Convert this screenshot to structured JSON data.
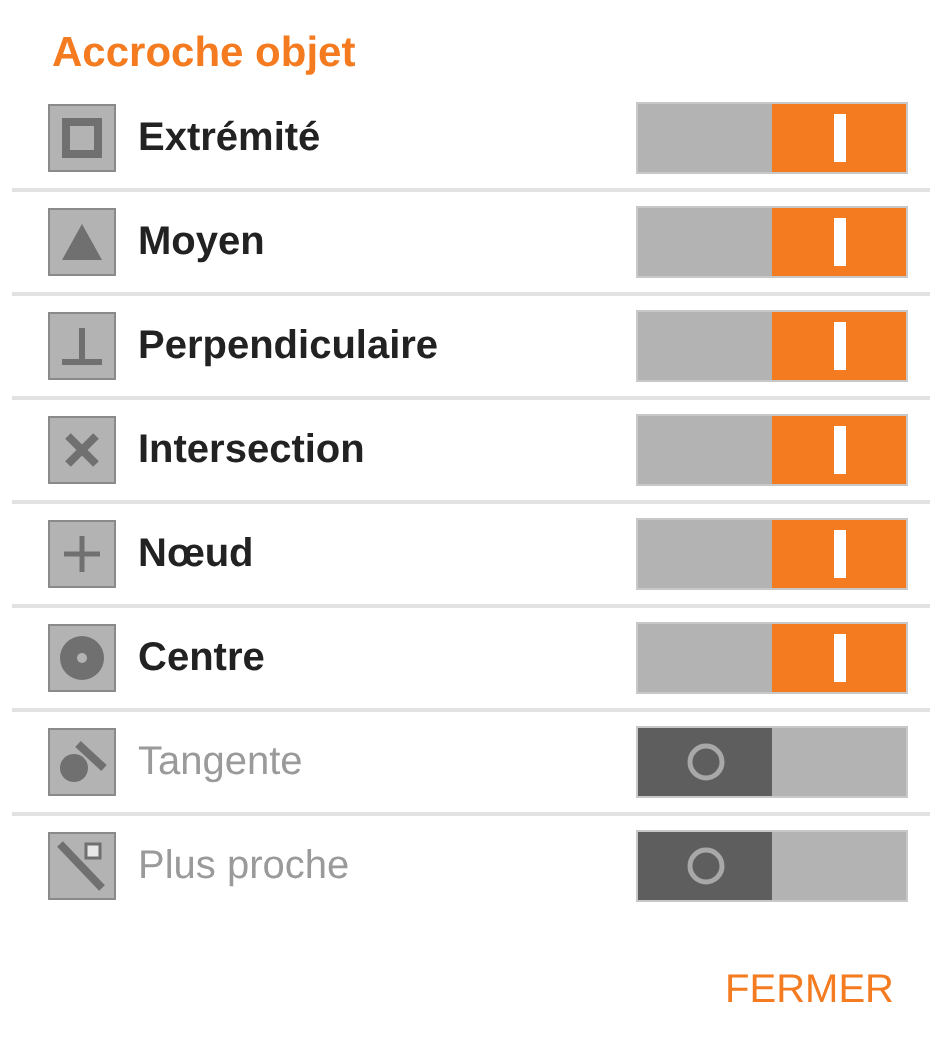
{
  "title": "Accroche objet",
  "options": [
    {
      "label": "Extrémité",
      "kind": "square",
      "on": true
    },
    {
      "label": "Moyen",
      "kind": "triangle",
      "on": true
    },
    {
      "label": "Perpendiculaire",
      "kind": "perpendicular",
      "on": true
    },
    {
      "label": "Intersection",
      "kind": "cross",
      "on": true
    },
    {
      "label": "Nœud",
      "kind": "plus",
      "on": true
    },
    {
      "label": "Centre",
      "kind": "circle",
      "on": true
    },
    {
      "label": "Tangente",
      "kind": "tangent",
      "on": false
    },
    {
      "label": "Plus proche",
      "kind": "nearest",
      "on": false
    }
  ],
  "close_button": "FERMER"
}
